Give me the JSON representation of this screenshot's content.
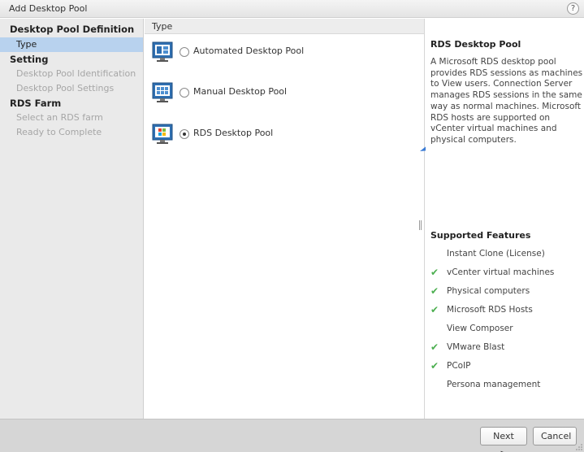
{
  "window": {
    "title": "Add Desktop Pool",
    "help_glyph": "?"
  },
  "sidebar": {
    "items": [
      {
        "label": "Desktop Pool Definition",
        "kind": "section"
      },
      {
        "label": "Type",
        "kind": "sub",
        "active": true
      },
      {
        "label": "Setting",
        "kind": "section"
      },
      {
        "label": "Desktop Pool Identification",
        "kind": "sub"
      },
      {
        "label": "Desktop Pool Settings",
        "kind": "sub"
      },
      {
        "label": "RDS Farm",
        "kind": "section"
      },
      {
        "label": "Select an RDS farm",
        "kind": "sub"
      },
      {
        "label": "Ready to Complete",
        "kind": "sub"
      }
    ]
  },
  "main": {
    "header": "Type",
    "options": [
      {
        "label": "Automated Desktop Pool",
        "icon": "automated-pool-icon",
        "selected": false
      },
      {
        "label": "Manual Desktop Pool",
        "icon": "manual-pool-icon",
        "selected": false
      },
      {
        "label": "RDS Desktop Pool",
        "icon": "rds-pool-icon",
        "selected": true
      }
    ]
  },
  "panel": {
    "title": "RDS Desktop Pool",
    "description": "A Microsoft RDS desktop pool provides RDS sessions as machines to View users. Connection Server manages RDS sessions in the same way as normal machines. Microsoft RDS hosts are supported on vCenter virtual machines and physical computers.",
    "features_title": "Supported Features",
    "features": [
      {
        "label": "Instant Clone (License)",
        "supported": false
      },
      {
        "label": "vCenter virtual machines",
        "supported": true
      },
      {
        "label": "Physical computers",
        "supported": true
      },
      {
        "label": "Microsoft RDS Hosts",
        "supported": true
      },
      {
        "label": "View Composer",
        "supported": false
      },
      {
        "label": "VMware Blast",
        "supported": true
      },
      {
        "label": "PCoIP",
        "supported": true
      },
      {
        "label": "Persona management",
        "supported": false
      }
    ],
    "check_glyph": "✔"
  },
  "footer": {
    "next_label": "Next >",
    "cancel_label": "Cancel"
  },
  "colors": {
    "accent_selection": "#b8d2ee",
    "check_green": "#4caf50",
    "arrow_blue": "#3a7bd5"
  }
}
